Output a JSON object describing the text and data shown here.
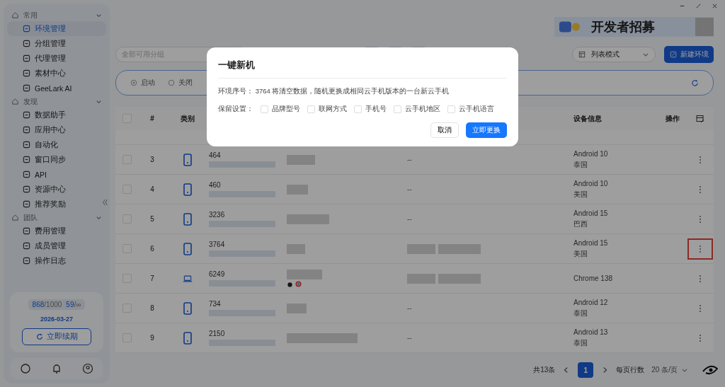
{
  "sidebar": {
    "sections": [
      {
        "label": "常用",
        "expanded": true,
        "items": [
          {
            "label": "环境管理",
            "selected": true
          },
          {
            "label": "分组管理",
            "selected": false
          },
          {
            "label": "代理管理",
            "selected": false
          },
          {
            "label": "素材中心",
            "selected": false
          },
          {
            "label": "GeeLark AI",
            "selected": false
          }
        ]
      },
      {
        "label": "发现",
        "expanded": true,
        "items": [
          {
            "label": "数据助手",
            "selected": false
          },
          {
            "label": "应用中心",
            "selected": false
          },
          {
            "label": "自动化",
            "selected": false
          },
          {
            "label": "窗口同步",
            "selected": false
          },
          {
            "label": "API",
            "selected": false
          },
          {
            "label": "资源中心",
            "selected": false
          },
          {
            "label": "推荐奖励",
            "selected": false
          }
        ]
      },
      {
        "label": "团队",
        "expanded": true,
        "items": [
          {
            "label": "费用管理",
            "selected": false
          },
          {
            "label": "成员管理",
            "selected": false
          },
          {
            "label": "操作日志",
            "selected": false
          }
        ]
      }
    ],
    "quota": {
      "envs_used": "868",
      "envs_total": "/1000",
      "members_used": "59",
      "members_total": "/∞",
      "expiry": "2026-03-27",
      "renew_button": "立即续期"
    }
  },
  "banner": {
    "text": "开发者招募"
  },
  "toolbar": {
    "group_select": {
      "placeholder": "全部可用分组"
    },
    "view_select": {
      "value": "列表模式"
    },
    "new_button": "新建环境"
  },
  "filter_bar": {
    "actions": [
      "启动",
      "关闭"
    ]
  },
  "table": {
    "all_selected": false,
    "columns": [
      "#",
      "类别",
      "设备信息",
      "操作"
    ],
    "rows": [
      {
        "index": "3",
        "kind": "phone",
        "serial": "464",
        "proxy": "--",
        "system": "Android 10",
        "region": "泰国",
        "highlighted": false,
        "selected": false
      },
      {
        "index": "4",
        "kind": "phone",
        "serial": "460",
        "proxy": "--",
        "system": "Android 10",
        "region": "美国",
        "highlighted": false,
        "selected": false
      },
      {
        "index": "5",
        "kind": "phone",
        "serial": "3236",
        "proxy": "--",
        "system": "Android 15",
        "region": "巴西",
        "highlighted": false,
        "selected": false
      },
      {
        "index": "6",
        "kind": "phone",
        "serial": "3764",
        "system": "Android 15",
        "region": "美国",
        "highlighted": true,
        "selected": false
      },
      {
        "index": "7",
        "kind": "laptop",
        "serial": "6249",
        "system": "Chrome 138",
        "highlighted": false,
        "selected": false
      },
      {
        "index": "8",
        "kind": "phone",
        "serial": "734",
        "proxy": "--",
        "system": "Android 12",
        "region": "泰国",
        "highlighted": false,
        "selected": false
      },
      {
        "index": "9",
        "kind": "phone",
        "serial": "2150",
        "proxy": "--",
        "system": "Android 13",
        "region": "泰国",
        "highlighted": false,
        "selected": false
      }
    ]
  },
  "pagination": {
    "total": "共13条",
    "pages": [
      {
        "label": "1",
        "selected": true
      }
    ],
    "rows_label": "每页行数",
    "page_size": "20 条/页"
  },
  "dialog": {
    "title": "一键新机",
    "message": "环境序号：  3764 将清空数据，随机更换成相同云手机版本的一台新云手机",
    "keep_label": "保留设置：",
    "options": [
      {
        "label": "品牌型号",
        "checked": false
      },
      {
        "label": "联网方式",
        "checked": false
      },
      {
        "label": "手机号",
        "checked": false
      },
      {
        "label": "云手机地区",
        "checked": false
      },
      {
        "label": "云手机语言",
        "checked": false
      }
    ],
    "cancel": "取消",
    "confirm": "立即更换"
  }
}
